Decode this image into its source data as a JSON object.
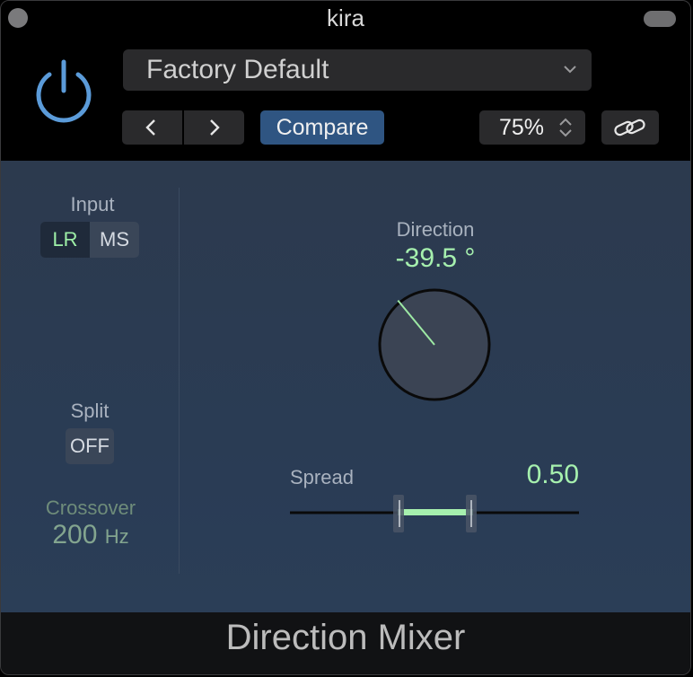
{
  "window": {
    "title": "kira"
  },
  "header": {
    "preset": "Factory Default",
    "compare_label": "Compare",
    "zoom": "75%"
  },
  "icons": [
    "power-icon",
    "chevron-down-icon",
    "chevron-left-icon",
    "chevron-right-icon",
    "up-down-arrows-icon",
    "link-icon"
  ],
  "input": {
    "label": "Input",
    "options": [
      "LR",
      "MS"
    ],
    "selected": "LR"
  },
  "split": {
    "label": "Split",
    "value": "OFF"
  },
  "crossover": {
    "label": "Crossover",
    "value": "200",
    "unit": "Hz"
  },
  "direction": {
    "label": "Direction",
    "value": "-39.5 °",
    "degrees": -39.5
  },
  "spread": {
    "label": "Spread",
    "value": "0.50"
  },
  "footer": {
    "plugin_name": "Direction Mixer"
  },
  "colors": {
    "accent_green": "#a6f0ae",
    "power_blue": "#5b9bd9",
    "compare_blue": "#2f5582",
    "panel": "#2c3a4e"
  }
}
